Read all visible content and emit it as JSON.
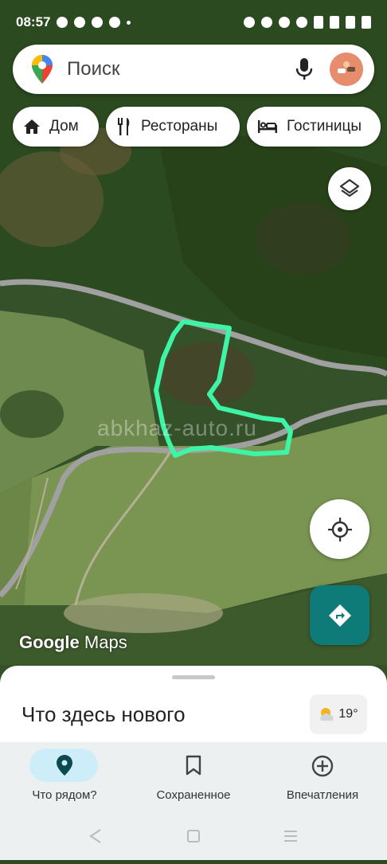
{
  "status_bar": {
    "time": "08:57"
  },
  "search": {
    "placeholder": "Поиск"
  },
  "chips": [
    {
      "label": "Дом",
      "icon": "home-icon"
    },
    {
      "label": "Рестораны",
      "icon": "restaurant-icon"
    },
    {
      "label": "Гостиницы",
      "icon": "hotel-icon"
    }
  ],
  "map": {
    "watermark": "abkhaz-auto.ru",
    "logo_google": "Google",
    "logo_maps": "Maps",
    "highlight_color": "#3df5a4"
  },
  "sheet": {
    "title": "Что здесь нового",
    "temperature": "19°"
  },
  "bottom_nav": [
    {
      "label": "Что рядом?",
      "icon": "location-pin-icon",
      "active": true
    },
    {
      "label": "Сохраненное",
      "icon": "bookmark-icon",
      "active": false
    },
    {
      "label": "Впечатления",
      "icon": "add-circle-icon",
      "active": false
    }
  ],
  "colors": {
    "accent": "#0f7b78",
    "nav_active_pill": "#cdeef8"
  }
}
